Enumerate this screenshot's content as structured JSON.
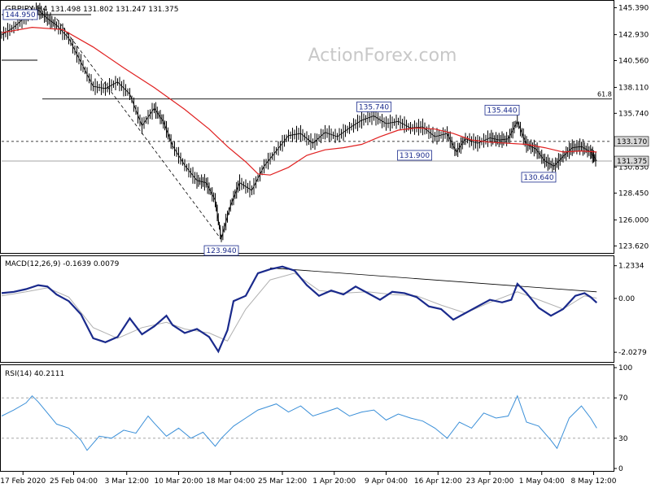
{
  "chart_data": [
    {
      "type": "candlestick",
      "title": "GBPJPY,H4",
      "ohlc_header": "131.498 131.802 131.247 131.375",
      "watermark": "ActionForex.com",
      "ylim": [
        123.2,
        145.8
      ],
      "y_ticks": [
        "145.390",
        "142.930",
        "140.560",
        "138.110",
        "135.740",
        "133.170",
        "130.830",
        "128.450",
        "126.000",
        "123.620"
      ],
      "y_tick_values": [
        145.39,
        142.93,
        140.56,
        138.11,
        135.74,
        133.17,
        130.83,
        128.45,
        126.0,
        123.62
      ],
      "current_price": {
        "label": "131.375",
        "value": 131.375
      },
      "horizontal_lines": [
        {
          "value": 137.05,
          "style": "solid",
          "label": "61.8"
        },
        {
          "value": 133.17,
          "style": "dashed",
          "label": "133.170"
        },
        {
          "value": 131.375,
          "style": "solid",
          "label": ""
        }
      ],
      "annotations": [
        {
          "text": "144.950",
          "x_frac": 0.02,
          "value": 144.5
        },
        {
          "text": "123.940",
          "x_frac": 0.36,
          "value": 123.94
        },
        {
          "text": "135.740",
          "x_frac": 0.61,
          "value": 135.74
        },
        {
          "text": "131.900",
          "x_frac": 0.71,
          "value": 131.9
        },
        {
          "text": "135.440",
          "x_frac": 0.82,
          "value": 135.44
        },
        {
          "text": "130.640",
          "x_frac": 0.88,
          "value": 130.64
        }
      ],
      "close_path": [
        [
          0.0,
          142.9
        ],
        [
          0.02,
          143.6
        ],
        [
          0.04,
          144.6
        ],
        [
          0.06,
          145.2
        ],
        [
          0.075,
          144.4
        ],
        [
          0.09,
          143.8
        ],
        [
          0.11,
          142.6
        ],
        [
          0.13,
          140.4
        ],
        [
          0.15,
          138.2
        ],
        [
          0.17,
          138.0
        ],
        [
          0.19,
          138.6
        ],
        [
          0.21,
          137.5
        ],
        [
          0.23,
          134.6
        ],
        [
          0.25,
          136.2
        ],
        [
          0.265,
          135.0
        ],
        [
          0.28,
          132.8
        ],
        [
          0.3,
          131.0
        ],
        [
          0.32,
          129.6
        ],
        [
          0.335,
          129.4
        ],
        [
          0.35,
          127.8
        ],
        [
          0.36,
          124.3
        ],
        [
          0.375,
          127.3
        ],
        [
          0.39,
          129.4
        ],
        [
          0.41,
          128.7
        ],
        [
          0.43,
          130.9
        ],
        [
          0.45,
          132.3
        ],
        [
          0.47,
          133.7
        ],
        [
          0.49,
          133.9
        ],
        [
          0.51,
          133.0
        ],
        [
          0.53,
          134.0
        ],
        [
          0.55,
          133.6
        ],
        [
          0.57,
          134.4
        ],
        [
          0.59,
          135.1
        ],
        [
          0.61,
          135.5
        ],
        [
          0.63,
          134.8
        ],
        [
          0.65,
          135.0
        ],
        [
          0.67,
          134.4
        ],
        [
          0.69,
          134.5
        ],
        [
          0.71,
          133.6
        ],
        [
          0.73,
          133.9
        ],
        [
          0.745,
          132.2
        ],
        [
          0.76,
          133.4
        ],
        [
          0.78,
          133.0
        ],
        [
          0.8,
          133.5
        ],
        [
          0.815,
          133.3
        ],
        [
          0.83,
          133.4
        ],
        [
          0.845,
          135.0
        ],
        [
          0.86,
          132.9
        ],
        [
          0.875,
          132.5
        ],
        [
          0.89,
          131.4
        ],
        [
          0.905,
          130.9
        ],
        [
          0.92,
          131.8
        ],
        [
          0.935,
          132.6
        ],
        [
          0.95,
          132.7
        ],
        [
          0.965,
          132.2
        ],
        [
          0.975,
          131.4
        ]
      ],
      "moving_average": [
        [
          0.0,
          143.1
        ],
        [
          0.05,
          143.6
        ],
        [
          0.1,
          143.4
        ],
        [
          0.15,
          141.8
        ],
        [
          0.2,
          139.9
        ],
        [
          0.25,
          138.1
        ],
        [
          0.3,
          136.1
        ],
        [
          0.34,
          134.3
        ],
        [
          0.37,
          132.7
        ],
        [
          0.4,
          131.3
        ],
        [
          0.42,
          130.2
        ],
        [
          0.44,
          130.1
        ],
        [
          0.47,
          130.8
        ],
        [
          0.5,
          131.9
        ],
        [
          0.53,
          132.4
        ],
        [
          0.56,
          132.6
        ],
        [
          0.59,
          132.9
        ],
        [
          0.62,
          133.6
        ],
        [
          0.65,
          134.2
        ],
        [
          0.68,
          134.4
        ],
        [
          0.71,
          134.3
        ],
        [
          0.74,
          133.9
        ],
        [
          0.77,
          133.3
        ],
        [
          0.8,
          133.1
        ],
        [
          0.83,
          133.0
        ],
        [
          0.86,
          132.9
        ],
        [
          0.89,
          132.6
        ],
        [
          0.92,
          132.2
        ],
        [
          0.95,
          132.3
        ],
        [
          0.975,
          132.2
        ]
      ],
      "trendlines": [
        {
          "from": [
            0.09,
            144.4
          ],
          "to": [
            0.36,
            124.2
          ],
          "style": "dashed"
        }
      ]
    },
    {
      "type": "line",
      "title": "MACD(12,26,9) -0.1639 0.0079",
      "ylim": [
        -2.3,
        1.5
      ],
      "y_ticks": [
        "1.2334",
        "0.00",
        "-2.0279"
      ],
      "y_tick_values": [
        1.2334,
        0.0,
        -2.0279
      ],
      "current_label": "0.0079",
      "series": [
        {
          "name": "MACD",
          "values": [
            [
              0.0,
              0.2
            ],
            [
              0.02,
              0.25
            ],
            [
              0.04,
              0.35
            ],
            [
              0.06,
              0.5
            ],
            [
              0.075,
              0.45
            ],
            [
              0.09,
              0.15
            ],
            [
              0.11,
              -0.1
            ],
            [
              0.13,
              -0.6
            ],
            [
              0.15,
              -1.5
            ],
            [
              0.17,
              -1.65
            ],
            [
              0.19,
              -1.45
            ],
            [
              0.21,
              -0.75
            ],
            [
              0.23,
              -1.35
            ],
            [
              0.25,
              -1.05
            ],
            [
              0.27,
              -0.65
            ],
            [
              0.28,
              -1.0
            ],
            [
              0.3,
              -1.3
            ],
            [
              0.32,
              -1.15
            ],
            [
              0.34,
              -1.45
            ],
            [
              0.355,
              -2.0
            ],
            [
              0.37,
              -1.2
            ],
            [
              0.38,
              -0.1
            ],
            [
              0.4,
              0.1
            ],
            [
              0.42,
              0.95
            ],
            [
              0.44,
              1.1
            ],
            [
              0.46,
              1.2
            ],
            [
              0.48,
              1.05
            ],
            [
              0.5,
              0.5
            ],
            [
              0.52,
              0.1
            ],
            [
              0.54,
              0.3
            ],
            [
              0.56,
              0.15
            ],
            [
              0.58,
              0.45
            ],
            [
              0.6,
              0.2
            ],
            [
              0.62,
              -0.05
            ],
            [
              0.64,
              0.25
            ],
            [
              0.66,
              0.2
            ],
            [
              0.68,
              0.05
            ],
            [
              0.7,
              -0.3
            ],
            [
              0.72,
              -0.4
            ],
            [
              0.74,
              -0.8
            ],
            [
              0.76,
              -0.55
            ],
            [
              0.78,
              -0.3
            ],
            [
              0.8,
              -0.05
            ],
            [
              0.82,
              -0.15
            ],
            [
              0.835,
              -0.05
            ],
            [
              0.845,
              0.55
            ],
            [
              0.86,
              0.2
            ],
            [
              0.88,
              -0.35
            ],
            [
              0.9,
              -0.65
            ],
            [
              0.92,
              -0.4
            ],
            [
              0.94,
              0.1
            ],
            [
              0.955,
              0.2
            ],
            [
              0.965,
              0.05
            ],
            [
              0.975,
              -0.16
            ]
          ]
        },
        {
          "name": "Signal",
          "values": [
            [
              0.0,
              0.1
            ],
            [
              0.04,
              0.25
            ],
            [
              0.075,
              0.4
            ],
            [
              0.11,
              0.05
            ],
            [
              0.15,
              -1.1
            ],
            [
              0.19,
              -1.5
            ],
            [
              0.23,
              -1.1
            ],
            [
              0.27,
              -0.9
            ],
            [
              0.3,
              -1.15
            ],
            [
              0.34,
              -1.3
            ],
            [
              0.37,
              -1.6
            ],
            [
              0.4,
              -0.4
            ],
            [
              0.44,
              0.7
            ],
            [
              0.48,
              0.95
            ],
            [
              0.52,
              0.3
            ],
            [
              0.56,
              0.2
            ],
            [
              0.6,
              0.25
            ],
            [
              0.64,
              0.15
            ],
            [
              0.68,
              0.1
            ],
            [
              0.72,
              -0.25
            ],
            [
              0.76,
              -0.55
            ],
            [
              0.8,
              -0.15
            ],
            [
              0.845,
              0.25
            ],
            [
              0.88,
              -0.05
            ],
            [
              0.92,
              -0.4
            ],
            [
              0.955,
              0.1
            ],
            [
              0.975,
              0.01
            ]
          ]
        }
      ],
      "trendlines": [
        {
          "from": [
            0.44,
            1.15
          ],
          "to": [
            0.975,
            0.25
          ],
          "style": "solid"
        }
      ]
    },
    {
      "type": "line",
      "title": "RSI(14) 40.2111",
      "ylim": [
        0,
        100
      ],
      "y_ticks": [
        "100",
        "70",
        "30",
        "0"
      ],
      "y_tick_values": [
        100,
        70,
        30,
        0
      ],
      "levels": [
        70,
        30
      ],
      "series": [
        {
          "name": "RSI",
          "values": [
            [
              0.0,
              52
            ],
            [
              0.02,
              58
            ],
            [
              0.04,
              65
            ],
            [
              0.05,
              72
            ],
            [
              0.06,
              66
            ],
            [
              0.075,
              55
            ],
            [
              0.09,
              44
            ],
            [
              0.11,
              40
            ],
            [
              0.13,
              28
            ],
            [
              0.14,
              18
            ],
            [
              0.16,
              32
            ],
            [
              0.18,
              30
            ],
            [
              0.2,
              38
            ],
            [
              0.22,
              35
            ],
            [
              0.24,
              52
            ],
            [
              0.25,
              45
            ],
            [
              0.27,
              32
            ],
            [
              0.29,
              40
            ],
            [
              0.31,
              30
            ],
            [
              0.33,
              36
            ],
            [
              0.35,
              22
            ],
            [
              0.36,
              30
            ],
            [
              0.38,
              42
            ],
            [
              0.4,
              50
            ],
            [
              0.42,
              58
            ],
            [
              0.44,
              62
            ],
            [
              0.45,
              64
            ],
            [
              0.47,
              56
            ],
            [
              0.49,
              62
            ],
            [
              0.51,
              52
            ],
            [
              0.53,
              56
            ],
            [
              0.55,
              60
            ],
            [
              0.57,
              52
            ],
            [
              0.59,
              56
            ],
            [
              0.61,
              58
            ],
            [
              0.63,
              48
            ],
            [
              0.65,
              54
            ],
            [
              0.67,
              50
            ],
            [
              0.69,
              47
            ],
            [
              0.71,
              40
            ],
            [
              0.73,
              30
            ],
            [
              0.75,
              46
            ],
            [
              0.77,
              40
            ],
            [
              0.79,
              55
            ],
            [
              0.81,
              50
            ],
            [
              0.83,
              52
            ],
            [
              0.845,
              72
            ],
            [
              0.86,
              46
            ],
            [
              0.88,
              42
            ],
            [
              0.9,
              28
            ],
            [
              0.91,
              20
            ],
            [
              0.93,
              50
            ],
            [
              0.95,
              62
            ],
            [
              0.965,
              50
            ],
            [
              0.975,
              40
            ]
          ]
        }
      ]
    }
  ],
  "x_axis": {
    "labels": [
      "17 Feb 2020",
      "25 Feb 04:00",
      "3 Mar 12:00",
      "10 Mar 20:00",
      "18 Mar 04:00",
      "25 Mar 12:00",
      "1 Apr 20:00",
      "9 Apr 04:00",
      "16 Apr 12:00",
      "23 Apr 20:00",
      "1 May 04:00",
      "8 May 12:00"
    ],
    "positions": [
      0.035,
      0.118,
      0.205,
      0.29,
      0.375,
      0.46,
      0.545,
      0.63,
      0.715,
      0.8,
      0.885,
      0.97
    ]
  },
  "colors": {
    "price_line": "#000000",
    "moving_average": "#e02020",
    "macd": "#1a2a8c",
    "signal": "#b0b0b0",
    "rsi": "#3a8fd8",
    "annotation_border": "#1a2a8c",
    "label_bg": "#d8d8d8"
  }
}
